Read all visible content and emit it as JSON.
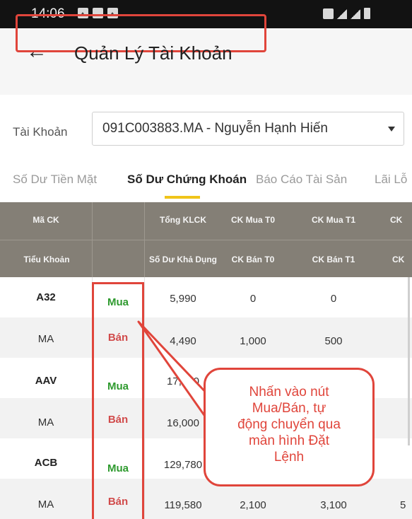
{
  "status_bar": {
    "time": "14:06",
    "left_icons": [
      "gallery-icon",
      "message-icon",
      "image-icon"
    ],
    "right_icons": [
      "alarm-icon",
      "signal-icon",
      "signal-icon",
      "battery-icon"
    ]
  },
  "app_bar": {
    "title": "Quản Lý Tài Khoản",
    "back_icon": "arrow-left-icon"
  },
  "account": {
    "label": "Tài Khoản",
    "value": "091C003883.MA - Nguyễn Hạnh Hiến"
  },
  "tabs": [
    {
      "label": "Số Dư Tiền Mặt",
      "active": false
    },
    {
      "label": "Số Dư Chứng Khoán",
      "active": true
    },
    {
      "label": "Báo Cáo Tài Sản",
      "active": false
    },
    {
      "label": "Lãi Lỗ",
      "active": false
    }
  ],
  "table": {
    "header_row1": [
      "Mã CK",
      "",
      "Tổng KLCK",
      "CK Mua T0",
      "CK Mua T1",
      "CK"
    ],
    "header_row2": [
      "Tiểu Khoản",
      "",
      "Số Dư Khả Dụng",
      "CK Bán T0",
      "CK Bán T1",
      "CK"
    ],
    "rows": [
      {
        "code": "A32",
        "action": "Mua",
        "total": "5,990",
        "t0": "0",
        "t1": "0",
        "extra": ""
      },
      {
        "code": "MA",
        "action": "Bán",
        "total": "4,490",
        "t0": "1,000",
        "t1": "500",
        "extra": ""
      },
      {
        "code": "AAV",
        "action": "Mua",
        "total": "17,000",
        "t0": "",
        "t1": "",
        "extra": ""
      },
      {
        "code": "MA",
        "action": "Bán",
        "total": "16,000",
        "t0": "",
        "t1": "",
        "extra": ""
      },
      {
        "code": "ACB",
        "action": "Mua",
        "total": "129,780",
        "t0": "",
        "t1": "",
        "extra": ""
      },
      {
        "code": "MA",
        "action": "Bán",
        "total": "119,580",
        "t0": "2,100",
        "t1": "3,100",
        "extra": "5"
      }
    ]
  },
  "callout": {
    "lines": [
      "Nhấn vào nút",
      "Mua/Bán, tự",
      "động chuyển qua",
      "màn hình Đặt",
      "Lệnh"
    ]
  },
  "colors": {
    "header_bg": "#847f76",
    "highlight": "#e0453b",
    "buy": "#2e9a2e",
    "sell": "#d14b4b",
    "tab_underline": "#f0c419"
  }
}
